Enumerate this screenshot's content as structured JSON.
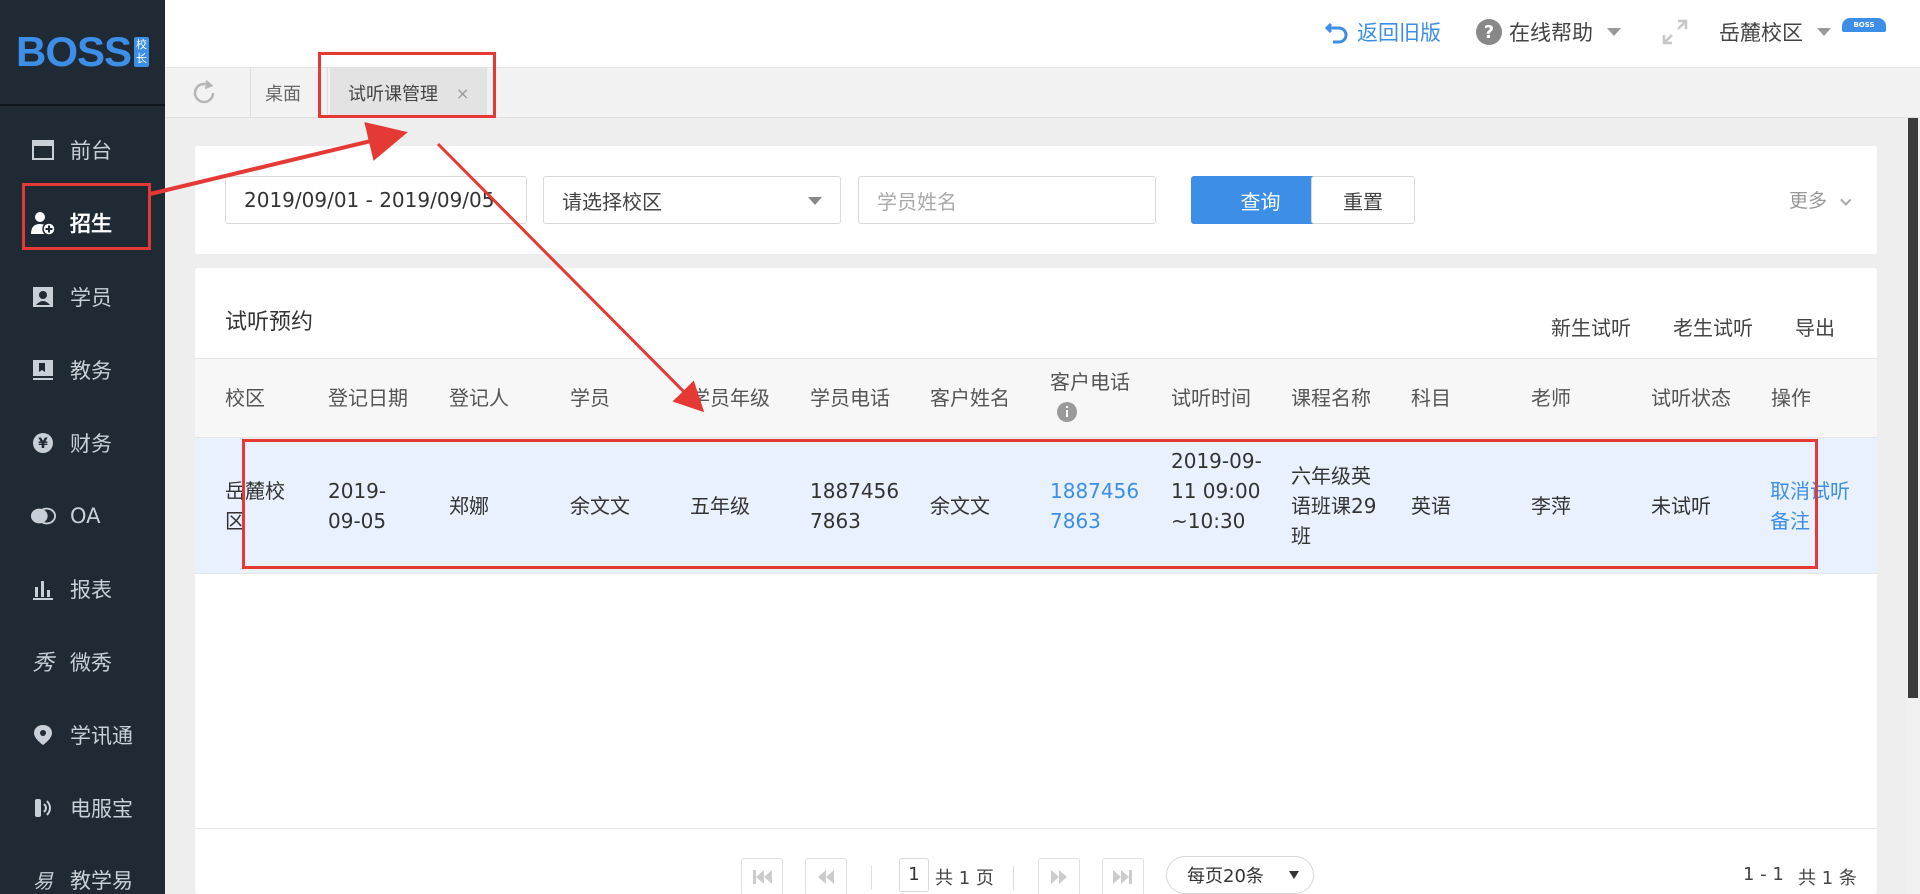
{
  "logo": {
    "text": "BOSS",
    "badge_top": "校",
    "badge_bottom": "长"
  },
  "sidebar": {
    "items": [
      {
        "label": "前台",
        "icon": "calendar-icon"
      },
      {
        "label": "招生",
        "icon": "add-user-icon",
        "active": true
      },
      {
        "label": "学员",
        "icon": "id-card-icon"
      },
      {
        "label": "教务",
        "icon": "book-icon"
      },
      {
        "label": "财务",
        "icon": "yen-icon"
      },
      {
        "label": "OA",
        "icon": "chat-icon"
      },
      {
        "label": "报表",
        "icon": "bar-chart-icon"
      },
      {
        "label": "微秀",
        "icon": "xiu-icon"
      },
      {
        "label": "学讯通",
        "icon": "location-icon"
      },
      {
        "label": "电服宝",
        "icon": "phone-icon"
      },
      {
        "label": "教学易",
        "icon": "teach-icon"
      }
    ]
  },
  "header": {
    "old_version": "返回旧版",
    "help": "在线帮助",
    "campus": "岳麓校区",
    "avatar_text": "BOSS"
  },
  "tabs": [
    {
      "label": "桌面"
    },
    {
      "label": "试听课管理",
      "close": "×"
    }
  ],
  "filters": {
    "date_range": "2019/09/01 - 2019/09/05",
    "campus_placeholder": "请选择校区",
    "student_placeholder": "学员姓名",
    "query": "查询",
    "reset": "重置",
    "more": "更多"
  },
  "table": {
    "title": "试听预约",
    "actions": [
      "新生试听",
      "老生试听",
      "导出"
    ],
    "columns": [
      "校区",
      "登记日期",
      "登记人",
      "学员",
      "学员年级",
      "学员电话",
      "客户姓名",
      "客户电话",
      "试听时间",
      "课程名称",
      "科目",
      "老师",
      "试听状态",
      "操作"
    ],
    "rows": [
      {
        "campus": "岳麓校区",
        "reg_date": "2019-09-05",
        "registrar": "郑娜",
        "student": "余文文",
        "grade": "五年级",
        "student_phone": "18874567863",
        "customer": "余文文",
        "customer_phone": "18874567863",
        "trial_time": "2019-09-11 09:00~10:30",
        "course": "六年级英语班课29班",
        "subject": "英语",
        "teacher": "李萍",
        "status": "未试听",
        "op_cancel": "取消试听",
        "op_note": "备注"
      }
    ]
  },
  "pager": {
    "page": "1",
    "total_pages": "共 1 页",
    "page_size": "每页20条",
    "range": "1 - 1",
    "total": "共 1 条"
  },
  "colors": {
    "sidebar_bg": "#1f2a35",
    "accent": "#3d8ee6",
    "annotation": "#e53935",
    "row_highlight": "#e8f1fd"
  }
}
